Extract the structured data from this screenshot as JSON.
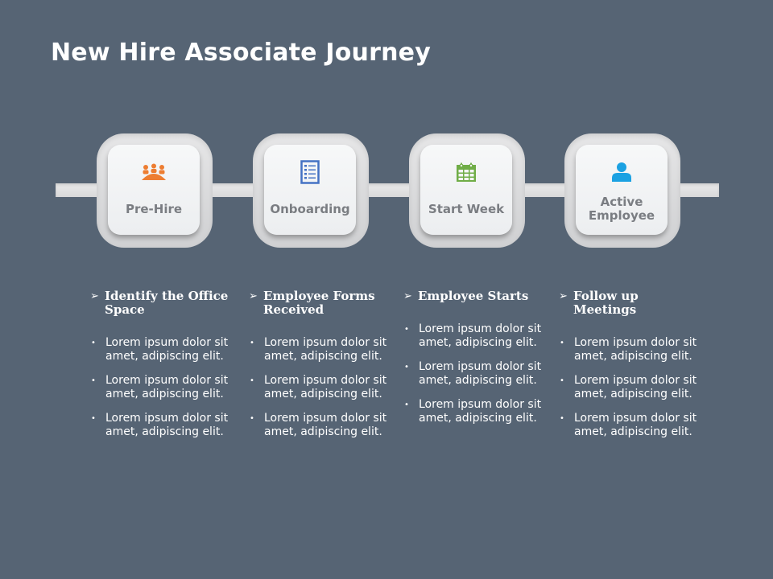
{
  "title": "New Hire Associate Journey",
  "steps": [
    {
      "label": "Pre-Hire",
      "icon": "team-meeting-icon",
      "icon_color": "#ED7D31"
    },
    {
      "label": "Onboarding",
      "icon": "checklist-icon",
      "icon_color": "#4472C4"
    },
    {
      "label": "Start Week",
      "icon": "calendar-icon",
      "icon_color": "#70AD47"
    },
    {
      "label": "Active Employee",
      "icon": "user-icon",
      "icon_color": "#1BA1E2"
    }
  ],
  "columns": [
    {
      "heading": "Identify the Office Space",
      "bullets": [
        "Lorem ipsum dolor sit amet, adipiscing elit.",
        "Lorem ipsum dolor sit amet, adipiscing elit.",
        "Lorem ipsum dolor sit amet, adipiscing elit."
      ]
    },
    {
      "heading": "Employee Forms Received",
      "bullets": [
        "Lorem ipsum dolor sit amet, adipiscing elit.",
        "Lorem ipsum dolor sit amet, adipiscing elit.",
        "Lorem ipsum dolor sit amet, adipiscing elit."
      ]
    },
    {
      "heading": "Employee Starts",
      "bullets": [
        "Lorem ipsum dolor sit amet, adipiscing elit.",
        "Lorem ipsum dolor sit amet, adipiscing elit.",
        "Lorem ipsum dolor sit amet, adipiscing elit."
      ]
    },
    {
      "heading": "Follow up Meetings",
      "bullets": [
        "Lorem ipsum dolor sit amet, adipiscing elit.",
        "Lorem ipsum dolor sit amet, adipiscing elit.",
        "Lorem ipsum dolor sit amet, adipiscing elit."
      ]
    }
  ],
  "symbols": {
    "heading_arrow": "➢",
    "bullet": "•"
  }
}
